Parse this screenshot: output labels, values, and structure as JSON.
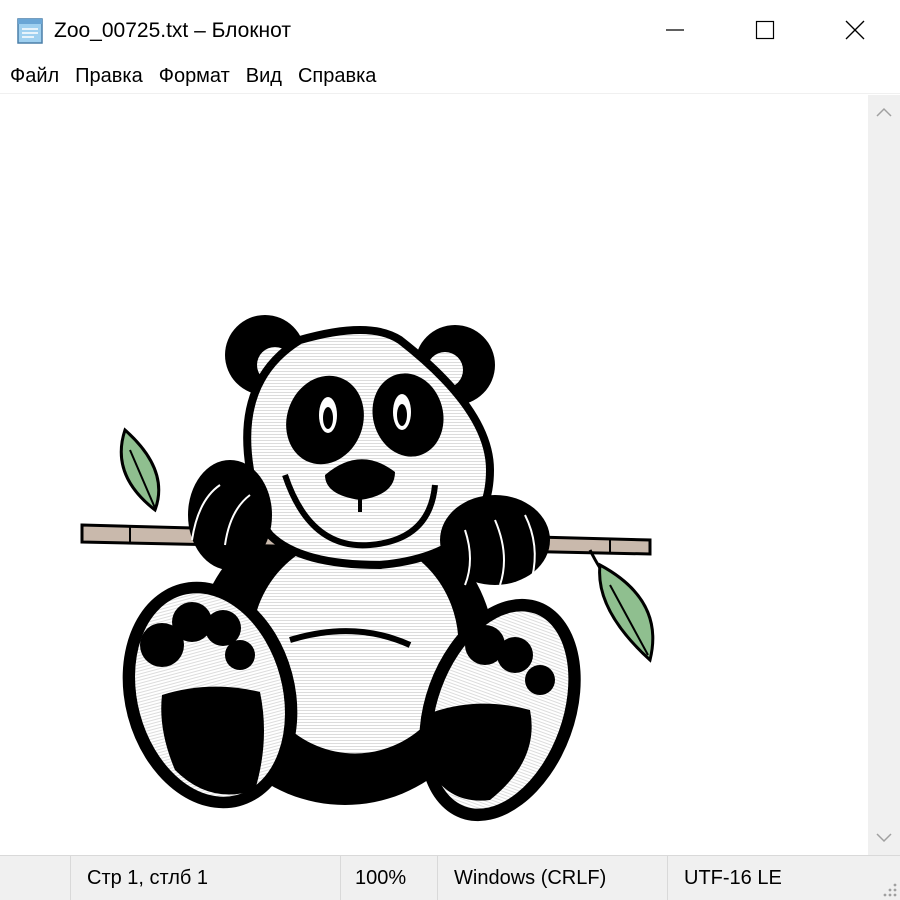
{
  "window": {
    "title": "Zoo_00725.txt – Блокнот",
    "icon": "notepad-icon",
    "controls": [
      "minimize-icon",
      "maximize-icon",
      "close-icon"
    ]
  },
  "menu": {
    "items": [
      {
        "label": "Файл"
      },
      {
        "label": "Правка"
      },
      {
        "label": "Формат"
      },
      {
        "label": "Вид"
      },
      {
        "label": "Справка"
      }
    ]
  },
  "editor": {
    "content_description_icon": "panda-ascii-art",
    "colors": {
      "ink": "#000000",
      "leaf": "#8fbf8f",
      "branch": "#c9b9ac"
    }
  },
  "status": {
    "position": "Стр 1, стлб 1",
    "zoom": "100%",
    "line_endings": "Windows (CRLF)",
    "encoding": "UTF-16 LE"
  }
}
